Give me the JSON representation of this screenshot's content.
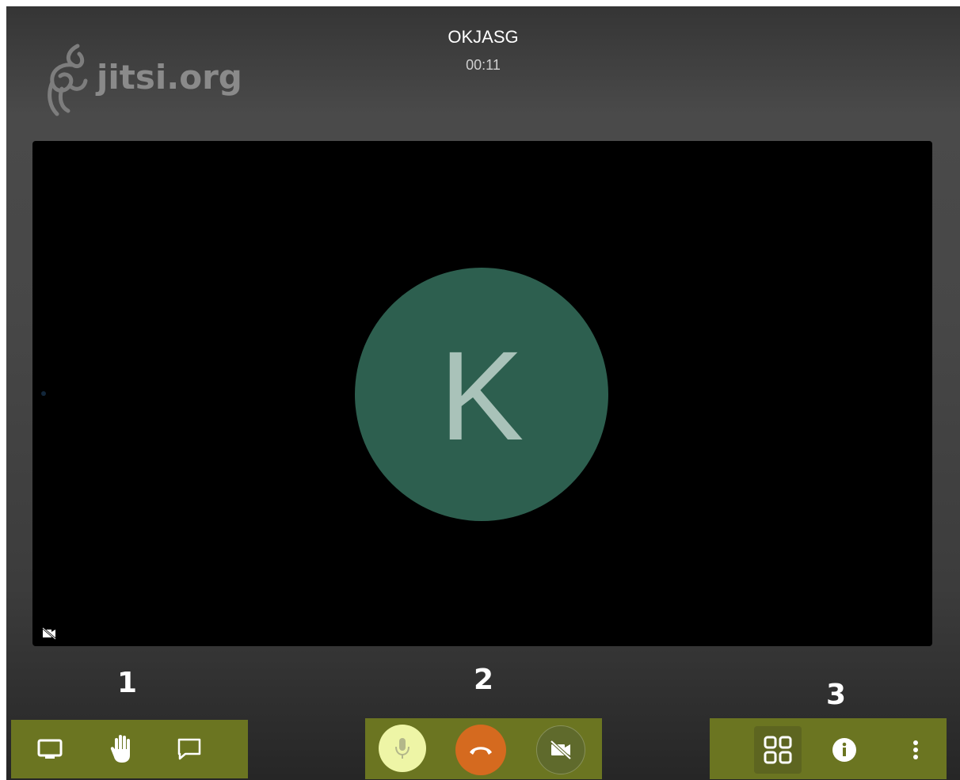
{
  "logo": {
    "text": "jitsi.org",
    "icon": "jitsi-logo-icon"
  },
  "meeting": {
    "title": "OKJASG",
    "timer": "00:11"
  },
  "participant": {
    "initial": "K",
    "avatar_color": "#2d5f4f"
  },
  "annotations": {
    "group1": "1",
    "group2": "2",
    "group3": "3"
  },
  "toolbar_left": [
    {
      "icon": "screen-share-icon"
    },
    {
      "icon": "raise-hand-icon"
    },
    {
      "icon": "chat-icon"
    }
  ],
  "toolbar_center": [
    {
      "icon": "microphone-icon",
      "color": "#eef5a6"
    },
    {
      "icon": "hangup-icon",
      "color": "#d56a1f"
    },
    {
      "icon": "camera-off-icon",
      "color": "#5f6a2c"
    }
  ],
  "toolbar_right": [
    {
      "icon": "tile-view-icon"
    },
    {
      "icon": "info-icon"
    },
    {
      "icon": "more-options-icon"
    }
  ],
  "colors": {
    "highlight": "#6b7521",
    "stage": "#000000",
    "hangup": "#d56a1f"
  }
}
